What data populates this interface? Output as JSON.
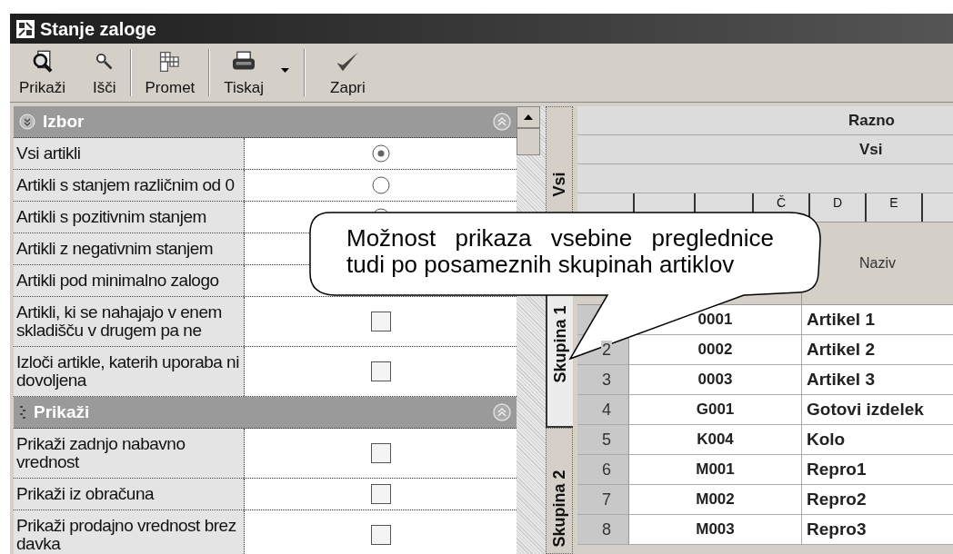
{
  "window": {
    "title": "Stanje zaloge"
  },
  "toolbar": [
    {
      "label": "Prikaži"
    },
    {
      "label": "Išči"
    },
    {
      "label": "Promet"
    },
    {
      "label": "Tiskaj",
      "dropdown": true
    },
    {
      "label": "Zapri"
    }
  ],
  "sections": [
    {
      "title": "Izbor",
      "expanded": true,
      "rows": [
        {
          "label": "Vsi artikli",
          "kind": "radio",
          "selected": true
        },
        {
          "label": "Artikli s stanjem različnim od 0",
          "kind": "radio",
          "selected": false
        },
        {
          "label": "Artikli s pozitivnim stanjem",
          "kind": "radio",
          "selected": false
        },
        {
          "label": "Artikli z negativnim stanjem"
        },
        {
          "label": "Artikli pod minimalno zalogo"
        },
        {
          "label": "Artikli, ki se nahajajo v enem skladišču v drugem pa ne",
          "kind": "checkbox",
          "checked": false
        },
        {
          "label": "Izloči artikle, katerih uporaba ni dovoljena",
          "kind": "checkbox",
          "checked": false
        }
      ]
    },
    {
      "title": "Prikaži",
      "expanded": true,
      "rows": [
        {
          "label": "Prikaži zadnjo nabavno vrednost",
          "kind": "checkbox",
          "checked": false
        },
        {
          "label": "Prikaži iz obračuna",
          "kind": "checkbox",
          "checked": false
        },
        {
          "label": "Prikaži prodajno vrednost brez davka",
          "kind": "checkbox",
          "checked": false
        }
      ]
    }
  ],
  "group_tabs": [
    {
      "label": "Vsi",
      "selected": false
    },
    {
      "label": "Skupina 1",
      "selected": true
    },
    {
      "label": "Skupina 2",
      "selected": false
    }
  ],
  "grid": {
    "header_1": "Razno",
    "header_2": "Vsi",
    "letter_tabs": [
      {
        "label": "Č"
      },
      {
        "label": "D"
      },
      {
        "label": "E"
      }
    ],
    "name_header": "Naziv",
    "rows": [
      {
        "code": "0001",
        "name": "Artikel 1"
      },
      {
        "number": "2",
        "code": "0002",
        "name": "Artikel 2"
      },
      {
        "number": "3",
        "code": "0003",
        "name": "Artikel 3"
      },
      {
        "number": "4",
        "code": "G001",
        "name": "Gotovi izdelek"
      },
      {
        "number": "5",
        "code": "K004",
        "name": "Kolo"
      },
      {
        "number": "6",
        "code": "M001",
        "name": "Repro1"
      },
      {
        "number": "7",
        "code": "M002",
        "name": "Repro2"
      },
      {
        "number": "8",
        "code": "M003",
        "name": "Repro3"
      }
    ]
  },
  "callout": {
    "text": "Možnost prikaza vsebine preglednice tudi po posameznih skupinah artiklov"
  }
}
